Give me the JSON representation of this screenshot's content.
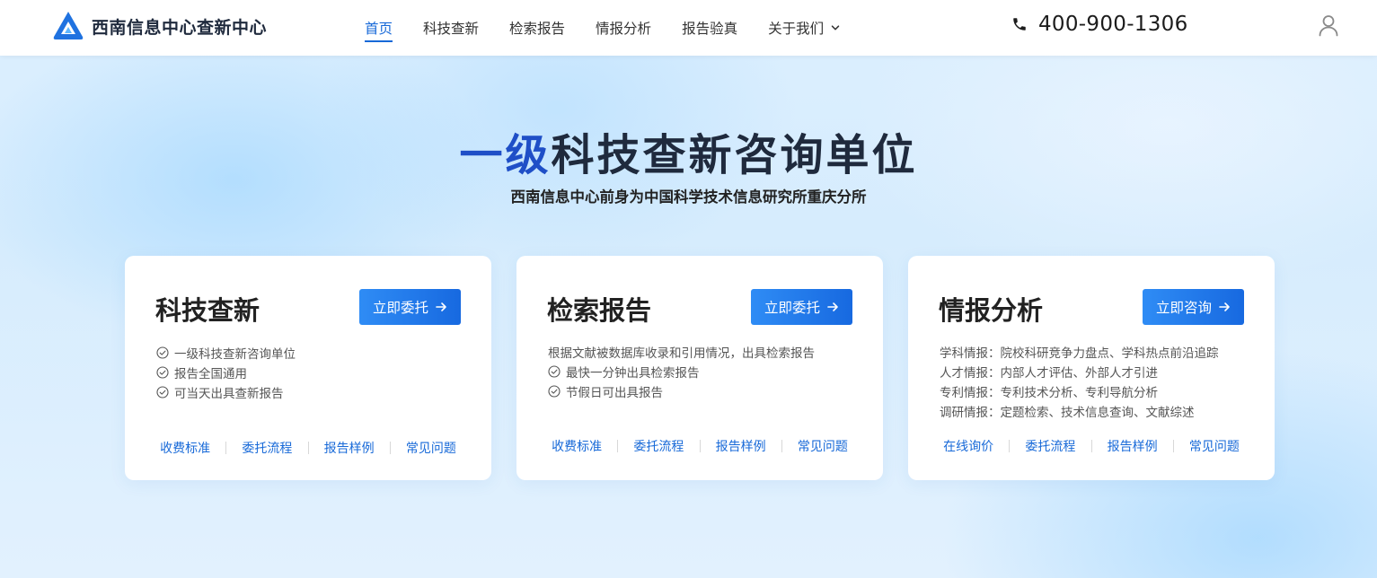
{
  "header": {
    "logo_text": "西南信息中心查新中心",
    "nav": [
      "首页",
      "科技查新",
      "检索报告",
      "情报分析",
      "报告验真",
      "关于我们"
    ],
    "active_index": 0,
    "phone": "400-900-1306"
  },
  "hero": {
    "title_accent": "一级",
    "title_rest": "科技查新咨询单位",
    "subtitle": "西南信息中心前身为中国科学技术信息研究所重庆分所"
  },
  "cards": [
    {
      "title": "科技查新",
      "cta": "立即委托",
      "lines": [
        {
          "text": "一级科技查新咨询单位",
          "check": true
        },
        {
          "text": "报告全国通用",
          "check": true
        },
        {
          "text": "可当天出具查新报告",
          "check": true
        }
      ],
      "links": [
        "收费标准",
        "委托流程",
        "报告样例",
        "常见问题"
      ]
    },
    {
      "title": "检索报告",
      "cta": "立即委托",
      "lines": [
        {
          "text": "根据文献被数据库收录和引用情况，出具检索报告",
          "check": false
        },
        {
          "text": "最快一分钟出具检索报告",
          "check": true
        },
        {
          "text": "节假日可出具报告",
          "check": true
        }
      ],
      "links": [
        "收费标准",
        "委托流程",
        "报告样例",
        "常见问题"
      ]
    },
    {
      "title": "情报分析",
      "cta": "立即咨询",
      "lines": [
        {
          "text": "学科情报：院校科研竞争力盘点、学科热点前沿追踪",
          "check": false
        },
        {
          "text": "人才情报：内部人才评估、外部人才引进",
          "check": false
        },
        {
          "text": "专利情报：专利技术分析、专利导航分析",
          "check": false
        },
        {
          "text": "调研情报：定题检索、技术信息查询、文献综述",
          "check": false
        }
      ],
      "links": [
        "在线询价",
        "委托流程",
        "报告样例",
        "常见问题"
      ]
    }
  ],
  "colors": {
    "brand_blue": "#1769d8",
    "title_accent": "#1f4fc7"
  },
  "icons": {
    "logo": "logo-mark-icon",
    "phone": "phone-icon",
    "user": "user-icon",
    "check": "check-circle-icon",
    "arrow": "arrow-right-icon",
    "dropdown": "chevron-down-icon"
  }
}
